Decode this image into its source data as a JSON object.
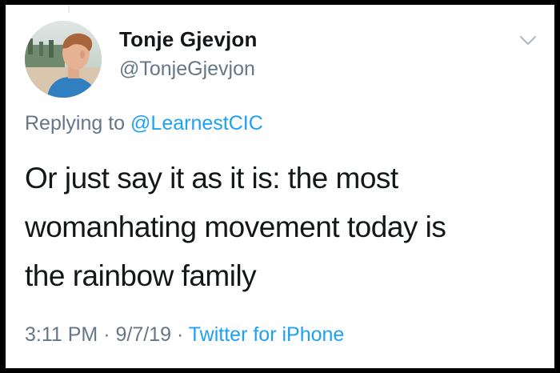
{
  "tweet": {
    "author": {
      "name": "Tonje Gjevjon",
      "handle": "@TonjeGjevjon"
    },
    "reply": {
      "prefix": "Replying to ",
      "mention": "@LearnestCIC"
    },
    "text_lines": [
      "Or just say it as it is: the most",
      "womanhating movement today is",
      "the rainbow family"
    ],
    "time": "3:11 PM",
    "separator": "·",
    "date": "9/7/19",
    "source": "Twitter for iPhone",
    "menu_icon": "chevron-down-icon"
  },
  "colors": {
    "text_primary": "#14171a",
    "text_secondary": "#657786",
    "link": "#1da1f2",
    "frame": "#000000",
    "card": "#ffffff"
  }
}
